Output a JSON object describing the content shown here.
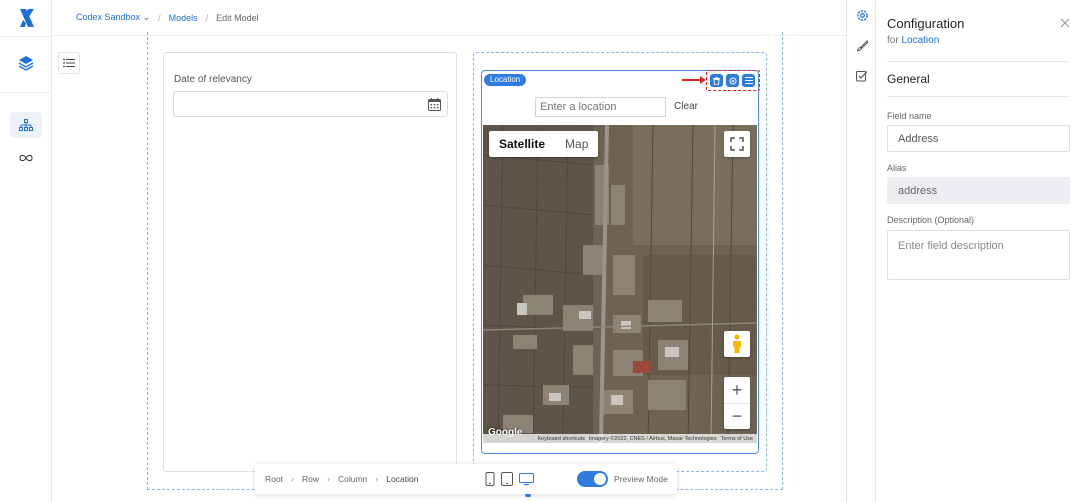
{
  "breadcrumb": {
    "workspace": "Codex Sandbox",
    "workspace_chevron": "⌄",
    "models": "Models",
    "current": "Edit Model",
    "separator": "/"
  },
  "form": {
    "date_field_label": "Date of relevancy",
    "location_tag": "Location",
    "location_placeholder": "Enter a location",
    "clear_label": "Clear"
  },
  "map": {
    "type_satellite": "Satellite",
    "type_map": "Map",
    "zoom_in": "+",
    "zoom_out": "−",
    "google": "Google",
    "attribution_shortcuts": "Keyboard shortcuts",
    "attribution_imagery": "Imagery ©2022, CNES / Airbus, Maxar Technologies",
    "attribution_terms": "Terms of Use"
  },
  "bottom_bar": {
    "path": [
      "Root",
      "Row",
      "Column",
      "Location"
    ],
    "chevron": "›",
    "preview_label": "Preview Mode",
    "preview_enabled": true
  },
  "config": {
    "title": "Configuration",
    "for_prefix": "for",
    "for_target": "Location",
    "section": "General",
    "field_name_label": "Field name",
    "field_name_value": "Address",
    "alias_label": "Alias",
    "alias_value": "address",
    "description_label": "Description (Optional)",
    "description_placeholder": "Enter field description"
  },
  "colors": {
    "accent": "#2f7be0",
    "link": "#1d6fd6",
    "annotation": "#e02424"
  },
  "icons": {
    "logo": "x-logo-icon",
    "layers": "layers-icon",
    "model_tree": "hierarchy-icon",
    "infinity": "infinity-icon",
    "list": "list-icon",
    "calendar": "calendar-icon",
    "trash": "trash-icon",
    "settings": "gear-icon",
    "menu": "menu-icon",
    "fullscreen": "fullscreen-icon",
    "pegman": "pegman-icon",
    "close": "close-icon",
    "brush": "brush-icon",
    "checklist": "checklist-icon"
  }
}
